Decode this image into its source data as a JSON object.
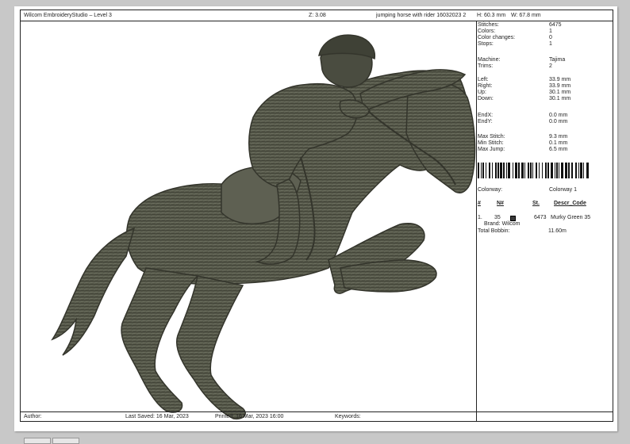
{
  "header": {
    "app_title": "Wilcom EmbroideryStudio – Level 3",
    "zoom": "Z: 3.08",
    "design_name": "jumping horse with rider 16032023 2",
    "height": "H: 60.3 mm",
    "width": "W: 67.8 mm"
  },
  "info": {
    "stitches_label": "Stitches:",
    "stitches": "6475",
    "colors_label": "Colors:",
    "colors": "1",
    "color_changes_label": "Color changes:",
    "color_changes": "0",
    "stops_label": "Stops:",
    "stops": "1",
    "machine_label": "Machine:",
    "machine": "Tajima",
    "trims_label": "Trims:",
    "trims": "2",
    "left_label": "Left:",
    "left": "33.9 mm",
    "right_label": "Right:",
    "right": "33.9 mm",
    "up_label": "Up:",
    "up": "30.1 mm",
    "down_label": "Down:",
    "down": "30.1 mm",
    "endx_label": "EndX:",
    "endx": "0.0 mm",
    "endy_label": "EndY:",
    "endy": "0.0 mm",
    "max_stitch_label": "Max Stitch:",
    "max_stitch": "9.3 mm",
    "min_stitch_label": "Min Stitch:",
    "min_stitch": "0.1 mm",
    "max_jump_label": "Max Jump:",
    "max_jump": "6.5 mm",
    "colorway_label": "Colorway:",
    "colorway": "Colorway 1"
  },
  "thread_table": {
    "headers": {
      "num": "#",
      "n": "N#",
      "st": "St.",
      "descr": "Descr_Code"
    },
    "row": {
      "num": "1.",
      "n": "35",
      "st": "6473",
      "descr": "Murky Green 35",
      "brand": "Brand: Wilcom",
      "color": "#3a3a3a"
    },
    "total_bobbin_label": "Total Bobbin:",
    "total_bobbin": "11.60m"
  },
  "footer": {
    "author": "Author:",
    "last_saved": "Last Saved: 16 Mar, 2023",
    "printed": "Printed: 16 Mar, 2023 16:00",
    "keywords": "Keywords:"
  },
  "design": {
    "thread_color": "#545648",
    "highlight_color": "#6d7060",
    "shadow_color": "#34352c"
  }
}
